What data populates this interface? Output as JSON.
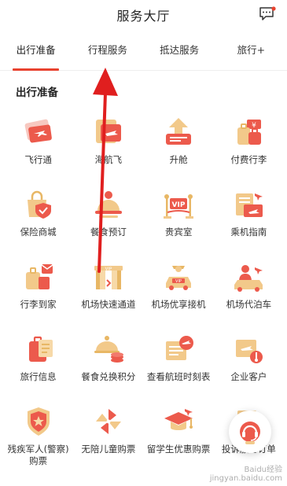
{
  "header": {
    "title": "服务大厅",
    "message_icon": "chat-bubble-icon"
  },
  "tabs": [
    {
      "label": "出行准备",
      "active": true
    },
    {
      "label": "行程服务"
    },
    {
      "label": "抵达服务"
    },
    {
      "label": "旅行+"
    }
  ],
  "section": {
    "title": "出行准备"
  },
  "grid": [
    {
      "label": "飞行通",
      "icon": "flight-ticket-icon"
    },
    {
      "label": "海航飞",
      "icon": "airline-card-icon"
    },
    {
      "label": "升舱",
      "icon": "upgrade-icon"
    },
    {
      "label": "付费行李",
      "icon": "paid-baggage-icon"
    },
    {
      "label": "保险商城",
      "icon": "insurance-bag-icon"
    },
    {
      "label": "餐食预订",
      "icon": "meal-icon"
    },
    {
      "label": "贵宾室",
      "icon": "vip-lounge-icon"
    },
    {
      "label": "乘机指南",
      "icon": "guide-book-icon"
    },
    {
      "label": "行李到家",
      "icon": "baggage-home-icon"
    },
    {
      "label": "机场快速通道",
      "icon": "vip-gate-icon"
    },
    {
      "label": "机场优享接机",
      "icon": "car-pickup-icon"
    },
    {
      "label": "机场代泊车",
      "icon": "valet-parking-icon"
    },
    {
      "label": "旅行信息",
      "icon": "luggage-info-icon"
    },
    {
      "label": "餐食兑换积分",
      "icon": "meal-points-icon"
    },
    {
      "label": "查看航班时刻表",
      "icon": "timetable-icon"
    },
    {
      "label": "企业客户",
      "icon": "corporate-icon"
    },
    {
      "label": "残疾军人(警察)购票",
      "icon": "military-badge-icon"
    },
    {
      "label": "无陪儿童购票",
      "icon": "pinwheel-icon"
    },
    {
      "label": "留学生优惠购票",
      "icon": "graduation-cap-icon"
    },
    {
      "label": "投诉服务订单",
      "icon": "complaint-order-icon"
    }
  ],
  "float_button": {
    "icon": "headset-support-icon"
  },
  "watermark": {
    "line1": "Baidu经验",
    "line2": "jingyan.baidu.com"
  },
  "colors": {
    "accent": "#e8422f",
    "gold": "#e8b765",
    "red_icon": "#ec5a4c"
  }
}
